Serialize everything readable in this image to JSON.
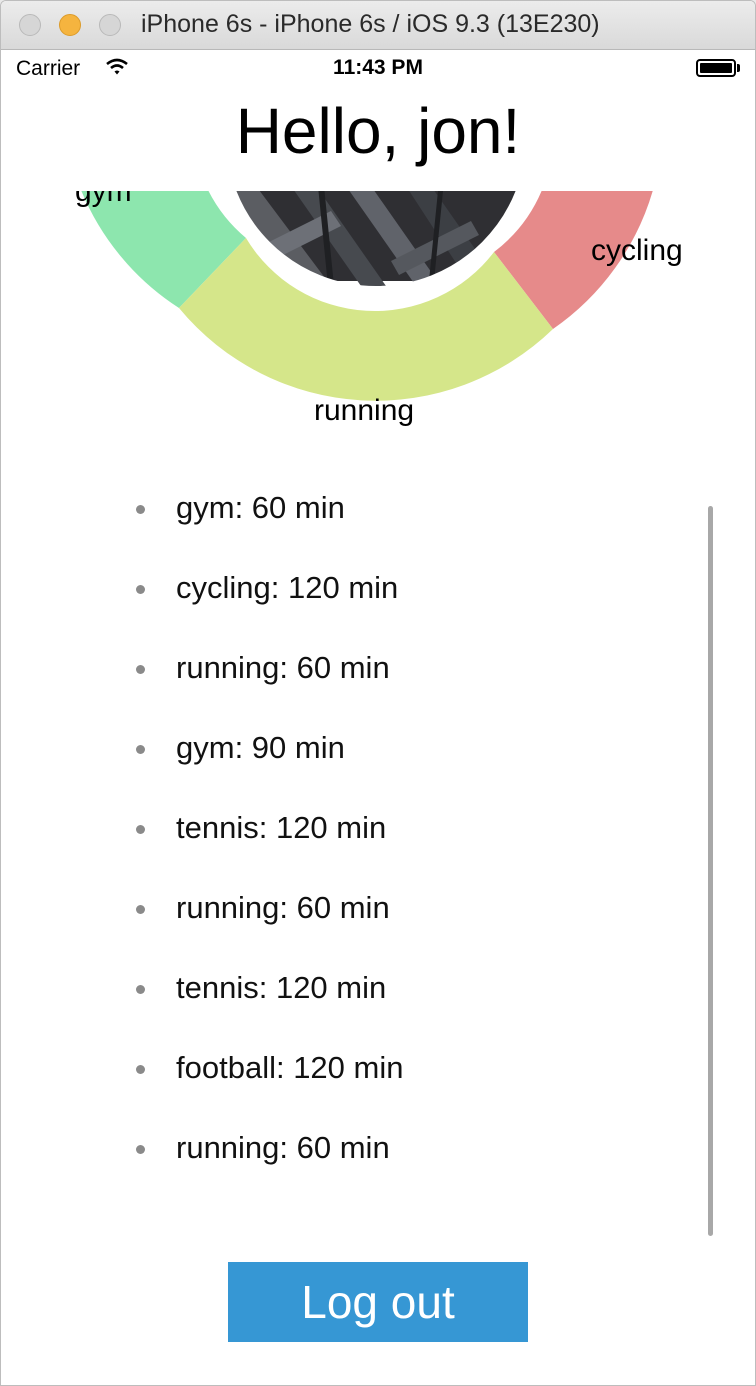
{
  "window": {
    "title": "iPhone 6s - iPhone 6s / iOS 9.3 (13E230)"
  },
  "status_bar": {
    "carrier": "Carrier",
    "time": "11:43 PM"
  },
  "greeting": "Hello, jon!",
  "chart_data": {
    "type": "pie",
    "categories": [
      "gym",
      "cycling",
      "running"
    ],
    "colors": [
      "#8de6ae",
      "#e68a8a",
      "#d5e68a"
    ],
    "center_image": "profile-photo"
  },
  "activities": [
    "gym: 60 min",
    "cycling: 120 min",
    "running: 60 min",
    "gym: 90 min",
    "tennis: 120 min",
    "running: 60 min",
    "tennis: 120 min",
    "football: 120 min",
    "running: 60 min"
  ],
  "logout_label": "Log out",
  "colors": {
    "button": "#3697d4",
    "bullet": "#8a8a8a"
  }
}
